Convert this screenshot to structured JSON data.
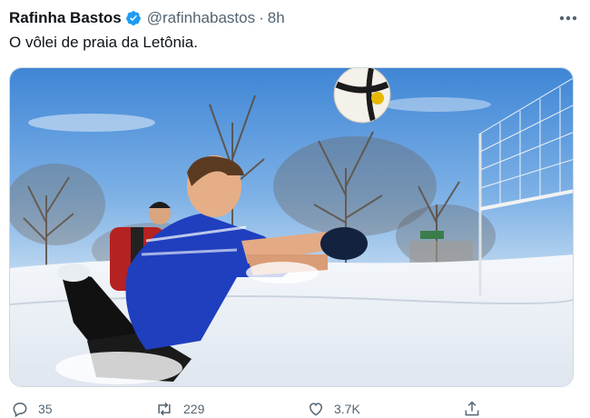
{
  "tweet": {
    "author_name": "Rafinha Bastos",
    "handle": "@rafinhabastos",
    "separator": "·",
    "time": "8h",
    "text": "O vôlei de praia da Letônia."
  },
  "actions": {
    "replies": "35",
    "retweets": "229",
    "likes": "3.7K"
  },
  "icons": {
    "verified": "verified-badge-icon",
    "more": "more-options-icon",
    "reply": "reply-icon",
    "retweet": "retweet-icon",
    "like": "heart-icon",
    "share": "share-icon"
  },
  "colors": {
    "verified_blue": "#1d9bf0",
    "text": "#0f1419",
    "muted": "#536471"
  }
}
